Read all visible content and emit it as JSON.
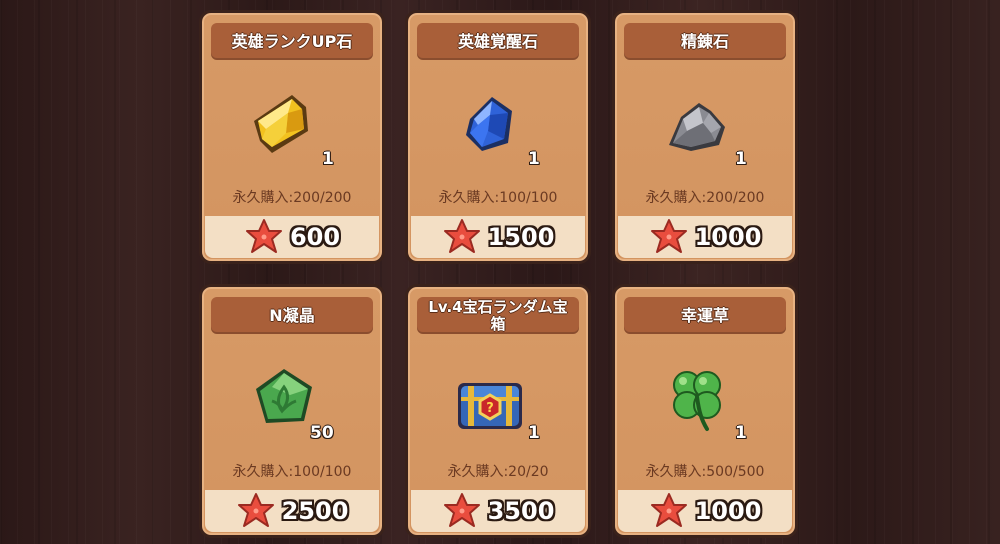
{
  "shop": {
    "items": [
      {
        "title": "英雄ランクUP石",
        "qty": "1",
        "limit": "永久購入:200/200",
        "price": "600",
        "icon": "gold-ingot-icon"
      },
      {
        "title": "英雄覚醒石",
        "qty": "1",
        "limit": "永久購入:100/100",
        "price": "1500",
        "icon": "blue-gem-icon"
      },
      {
        "title": "精錬石",
        "qty": "1",
        "limit": "永久購入:200/200",
        "price": "1000",
        "icon": "gray-stone-icon"
      },
      {
        "title": "N凝晶",
        "qty": "50",
        "limit": "永久購入:100/100",
        "price": "2500",
        "icon": "green-crystal-icon"
      },
      {
        "title": "Lv.4宝石ランダム宝箱",
        "qty": "1",
        "limit": "永久購入:20/20",
        "price": "3500",
        "icon": "treasure-chest-icon"
      },
      {
        "title": "幸運草",
        "qty": "1",
        "limit": "永久購入:500/500",
        "price": "1000",
        "icon": "four-leaf-clover-icon"
      }
    ]
  },
  "colors": {
    "card": "#d79a66",
    "title_bar": "#a95f39",
    "price_bar": "#f3dfc5",
    "currency_star": "#e94d3e"
  },
  "currency_icon": "red-starfish-icon"
}
